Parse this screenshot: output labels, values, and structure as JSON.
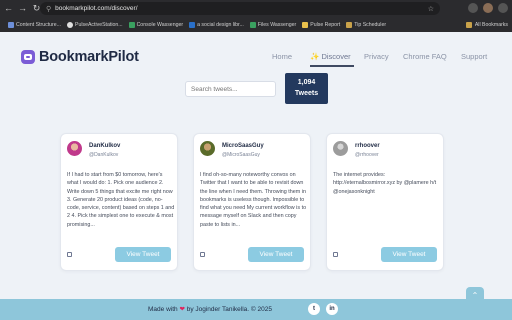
{
  "browser": {
    "url": "bookmarkpilot.com/discover/",
    "bookmarks": [
      "Content Structure...",
      "PulseActiveStation...",
      "Console Wassenger",
      "a social design libr...",
      "Files Wassenger",
      "Pulse Report",
      "Tip Scheduler"
    ],
    "all_bookmarks": "All Bookmarks"
  },
  "brand": {
    "name": "BookmarkPilot"
  },
  "nav": {
    "home": "Home",
    "discover": "Discover",
    "discover_icon": "✨",
    "privacy": "Privacy",
    "chrome_faq": "Chrome FAQ",
    "support": "Support"
  },
  "search": {
    "placeholder": "Search tweets..."
  },
  "counter": {
    "value": "1,094",
    "label": "Tweets"
  },
  "cards": [
    {
      "name": "DanKulkov",
      "handle": "@DanKulkov",
      "text": "If I had to start from $0 tomorrow, here's what I would do: 1. Pick one audience 2. Write down 5 things that excite me right now 3. Generate 20 product ideas (code, no-code, service, content) based on steps 1 and 2 4. Pick the simplest one to execute & most promising...",
      "button": "View Tweet"
    },
    {
      "name": "MicroSaasGuy",
      "handle": "@MicroSaasGuy",
      "text": "I find oh-so-many noteworthy convos on Twitter that I want to be able to revisit down the line when I need them. Throwing them in bookmarks is useless though. Impossible to find what you need My current workflow is to message myself on Slack and then copy paste to lists in...",
      "button": "View Tweet"
    },
    {
      "name": "rrhoover",
      "handle": "@rrhoover",
      "text": "The internet provides: http://eternalbosmirror.xyz by @plamere h/t @onejasonknight",
      "button": "View Tweet"
    }
  ],
  "footer": {
    "prefix": "Made with",
    "suffix": "by Joginder Tanikella. © 2025",
    "twitter": "t",
    "linkedin": "in"
  }
}
